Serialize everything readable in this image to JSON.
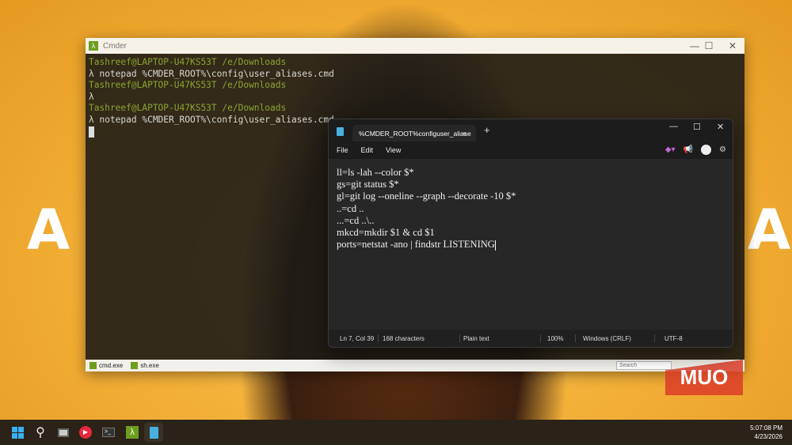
{
  "cmder": {
    "title": "Cmder",
    "lines": [
      {
        "prompt": "Tashreef@LAPTOP-U47KS53T /e/Downloads"
      },
      {
        "cmd": "λ notepad %CMDER_ROOT%\\config\\user_aliases.cmd"
      },
      {
        "prompt": "Tashreef@LAPTOP-U47KS53T /e/Downloads"
      },
      {
        "cmd": "λ"
      },
      {
        "prompt": "Tashreef@LAPTOP-U47KS53T /e/Downloads"
      },
      {
        "cmd": "λ notepad %CMDER_ROOT%\\config\\user_aliases.cmd"
      }
    ],
    "tabs": [
      "cmd.exe",
      "sh.exe"
    ],
    "search_placeholder": "Search"
  },
  "notepad": {
    "tab_title": "%CMDER_ROOT%configuser_aliase",
    "menu": [
      "File",
      "Edit",
      "View"
    ],
    "lines": [
      "ll=ls -lah --color $*",
      "gs=git status $*",
      "gl=git log --oneline --graph --decorate -10 $*",
      "..=cd ..",
      "...=cd ..\\..",
      "mkcd=mkdir $1 & cd $1",
      "ports=netstat -ano | findstr LISTENING"
    ],
    "status": {
      "position": "Ln 7, Col 39",
      "chars": "168 characters",
      "format": "Plain text",
      "zoom": "100%",
      "line_ending": "Windows (CRLF)",
      "encoding": "UTF-8"
    }
  },
  "watermark": "MUO",
  "taskbar": {
    "time": "5:07:08 PM",
    "date": "4/23/2026"
  }
}
